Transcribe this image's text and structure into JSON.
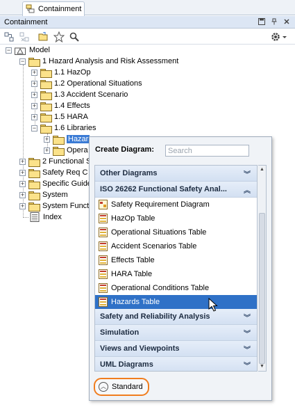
{
  "tab": {
    "label": "Containment"
  },
  "panel": {
    "title": "Containment",
    "buttons": [
      "save-layout",
      "pin",
      "close"
    ]
  },
  "toolbar": {
    "icons": [
      "collapse-all",
      "expand",
      "open-folder",
      "star",
      "search",
      "settings"
    ]
  },
  "tree": {
    "model": "Model",
    "n1": "1 Hazard Analysis and Risk Assessment",
    "n1_1": "1.1 HazOp",
    "n1_2": "1.2 Operational Situations",
    "n1_3": "1.3 Accident Scenario",
    "n1_4": "1.4 Effects",
    "n1_5": "1.5 HARA",
    "n1_6": "1.6 Libraries",
    "n1_6_1": "Hazar",
    "n1_6_2": "Opera",
    "n2": "2 Functional S",
    "n3": "Safety Req C",
    "n4": "Specific Guide",
    "n5": "System",
    "n6": "System Funct",
    "n7": "Index"
  },
  "popup": {
    "create_label": "Create Diagram:",
    "search_placeholder": "Search",
    "groups": {
      "other": "Other Diagrams",
      "iso": "ISO 26262 Functional Safety Anal...",
      "safety": "Safety and Reliability Analysis",
      "simulation": "Simulation",
      "views": "Views and Viewpoints",
      "uml": "UML Diagrams"
    },
    "items": [
      "Safety Requirement Diagram",
      "HazOp Table",
      "Operational Situations Table",
      "Accident Scenarios Table",
      "Effects Table",
      "HARA Table",
      "Operational Conditions Table",
      "Hazards Table"
    ],
    "standard_label": "Standard"
  },
  "colors": {
    "selection": "#2f71c7",
    "highlight_ring": "#f07d1e",
    "header_bg": "#dce6f4"
  }
}
